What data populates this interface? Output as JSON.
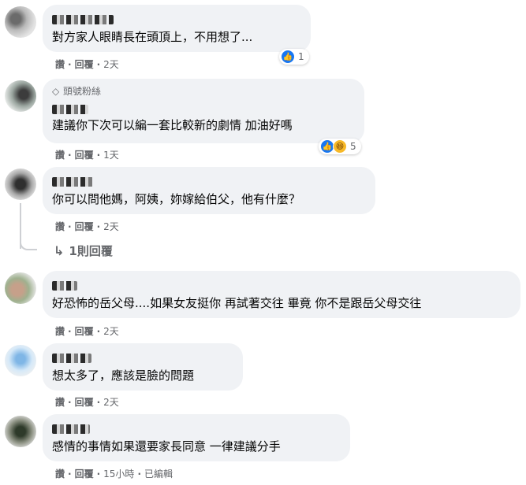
{
  "comments": [
    {
      "text": "對方家人眼睛長在頭頂上，不用想了...",
      "actions": {
        "like": "讚",
        "reply": "回覆",
        "time": "2天"
      },
      "reactions": {
        "icons": [
          "like-icon"
        ],
        "count": "1"
      }
    },
    {
      "badge": "頭號粉絲",
      "text": "建議你下次可以編一套比較新的劇情 加油好嗎",
      "actions": {
        "like": "讚",
        "reply": "回覆",
        "time": "1天"
      },
      "reactions": {
        "icons": [
          "like-icon",
          "haha-icon"
        ],
        "count": "5"
      }
    },
    {
      "text": "你可以問他媽，阿姨，妳嫁給伯父，他有什麼？",
      "actions": {
        "like": "讚",
        "reply": "回覆",
        "time": "2天"
      },
      "replies_link": "1則回覆"
    },
    {
      "text": "好恐怖的岳父母....如果女友挺你 再試著交往 畢竟 你不是跟岳父母交往",
      "actions": {
        "like": "讚",
        "reply": "回覆",
        "time": "2天"
      }
    },
    {
      "text": "想太多了，應該是臉的問題",
      "actions": {
        "like": "讚",
        "reply": "回覆",
        "time": "2天"
      }
    },
    {
      "text": "感情的事情如果還要家長同意 一律建議分手",
      "actions": {
        "like": "讚",
        "reply": "回覆",
        "time": "15小時",
        "edited": "已編輯"
      }
    }
  ],
  "colors": {
    "bubble": "#f0f2f5",
    "meta": "#65676b",
    "like": "#1877f2",
    "haha": "#f7b928"
  }
}
